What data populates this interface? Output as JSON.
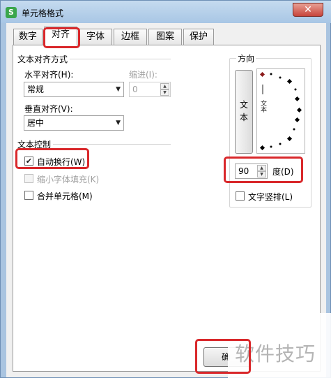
{
  "window": {
    "title": "单元格格式",
    "icon_letter": "S",
    "close_symbol": "✕"
  },
  "tabs": [
    {
      "label": "数字"
    },
    {
      "label": "对齐",
      "active": true
    },
    {
      "label": "字体"
    },
    {
      "label": "边框"
    },
    {
      "label": "图案"
    },
    {
      "label": "保护"
    }
  ],
  "text_alignment": {
    "group_label": "文本对齐方式",
    "horizontal_label": "水平对齐(H):",
    "horizontal_value": "常规",
    "indent_label": "缩进(I):",
    "indent_value": "0",
    "vertical_label": "垂直对齐(V):",
    "vertical_value": "居中"
  },
  "text_control": {
    "group_label": "文本控制",
    "wrap_text_label": "自动换行(W)",
    "wrap_text_checked": true,
    "shrink_to_fit_label": "缩小字体填充(K)",
    "shrink_to_fit_checked": false,
    "merge_cells_label": "合并单元格(M)",
    "merge_cells_checked": false
  },
  "orientation": {
    "group_label": "方向",
    "vertical_text_button": "文本",
    "dial_text": "文本",
    "degrees_value": "90",
    "degrees_label": "度(D)",
    "stacked_text_label": "文字竖排(L)",
    "stacked_text_checked": false
  },
  "footer": {
    "ok_label": "确"
  },
  "watermark": "软件技巧",
  "colors": {
    "highlight": "#d9282b",
    "dial_marker": "#8b1a1a"
  }
}
